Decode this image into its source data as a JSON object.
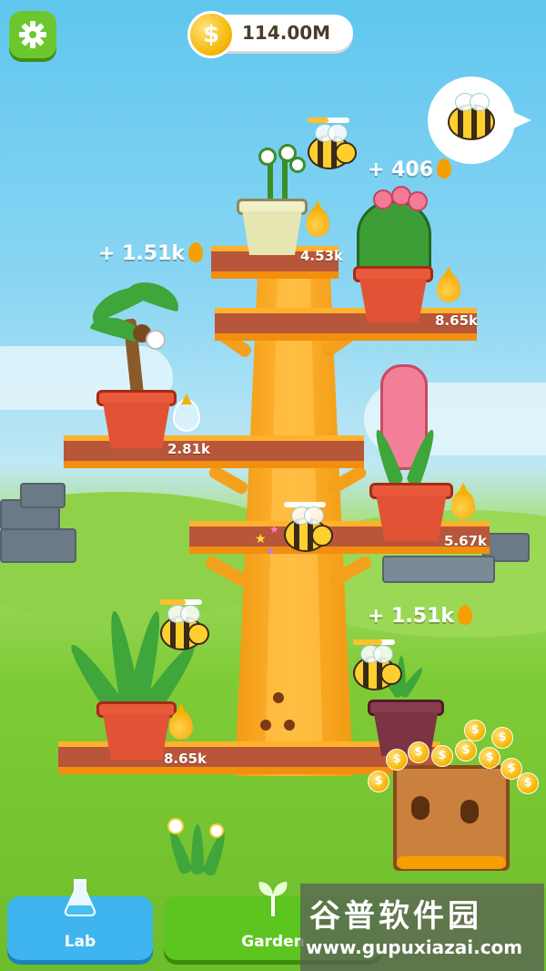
{
  "header": {
    "coin_symbol": "$",
    "coin_amount": "114.00M"
  },
  "hint_bubble": {
    "icon": "bee-icon"
  },
  "plants": [
    {
      "name": "daisy",
      "rate": "4.53k",
      "pot": "cream"
    },
    {
      "name": "cactus",
      "rate": "8.65k",
      "pot": "terracotta"
    },
    {
      "name": "coconut-palm",
      "rate": "2.81k",
      "pot": "terracotta"
    },
    {
      "name": "hyacinth",
      "rate": "5.67k",
      "pot": "terracotta"
    },
    {
      "name": "aloe",
      "rate": "8.65k",
      "pot": "terracotta"
    },
    {
      "name": "cannabis",
      "rate": "",
      "pot": "purple"
    }
  ],
  "gains": [
    {
      "text": "+ 406"
    },
    {
      "text": "+ 1.51k"
    },
    {
      "text": "+ 1.51k"
    }
  ],
  "bees": [
    {
      "progress": 0.5
    },
    {
      "progress": 0.0
    },
    {
      "progress": 0.6
    },
    {
      "progress": 0.7
    }
  ],
  "bottom_bar": {
    "lab_label": "Lab",
    "garden_label": "Garden"
  },
  "watermark": {
    "title": "谷普软件园",
    "url": "www.gupuxiazai.com"
  },
  "colors": {
    "accent_orange": "#f5a01c",
    "lab_blue": "#3fb5ef",
    "garden_green": "#5cc520"
  }
}
